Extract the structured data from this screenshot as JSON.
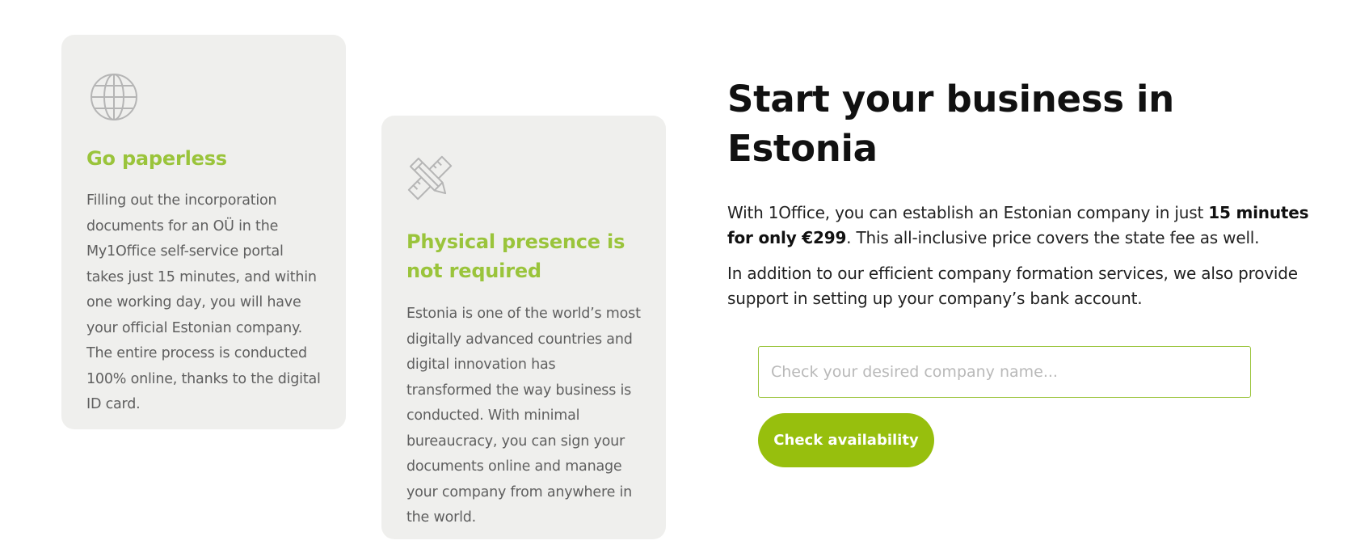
{
  "cards": [
    {
      "icon": "globe-icon",
      "title": "Go paperless",
      "body": "Filling out the incorporation documents for an OÜ in the My1Office self-service portal takes just 15 minutes, and within one working day, you will have your official Estonian company. The entire process is conducted 100% online, thanks to the digital ID card."
    },
    {
      "icon": "pencil-ruler-icon",
      "title": "Physical presence is not required",
      "body": "Estonia is one of the world’s most digitally advanced countries and digital innovation has transformed the way business is conducted. With minimal bureaucracy, you can sign your documents online and manage your company from anywhere in the world."
    }
  ],
  "main": {
    "heading": "Start your business in Estonia",
    "intro_prefix": "With 1Office, you can establish an Estonian company in just ",
    "intro_bold": "15 minutes for only €299",
    "intro_suffix": ". This all-inclusive price covers the state fee as well.",
    "intro2": "In addition to our efficient company formation services, we also provide support in setting up your company’s bank account."
  },
  "search": {
    "placeholder": "Check your desired company name...",
    "value": ""
  },
  "button": {
    "label": "Check availability"
  },
  "colors": {
    "accent": "#9ac43b",
    "button": "#97bf0d",
    "card_bg": "#efefed"
  }
}
